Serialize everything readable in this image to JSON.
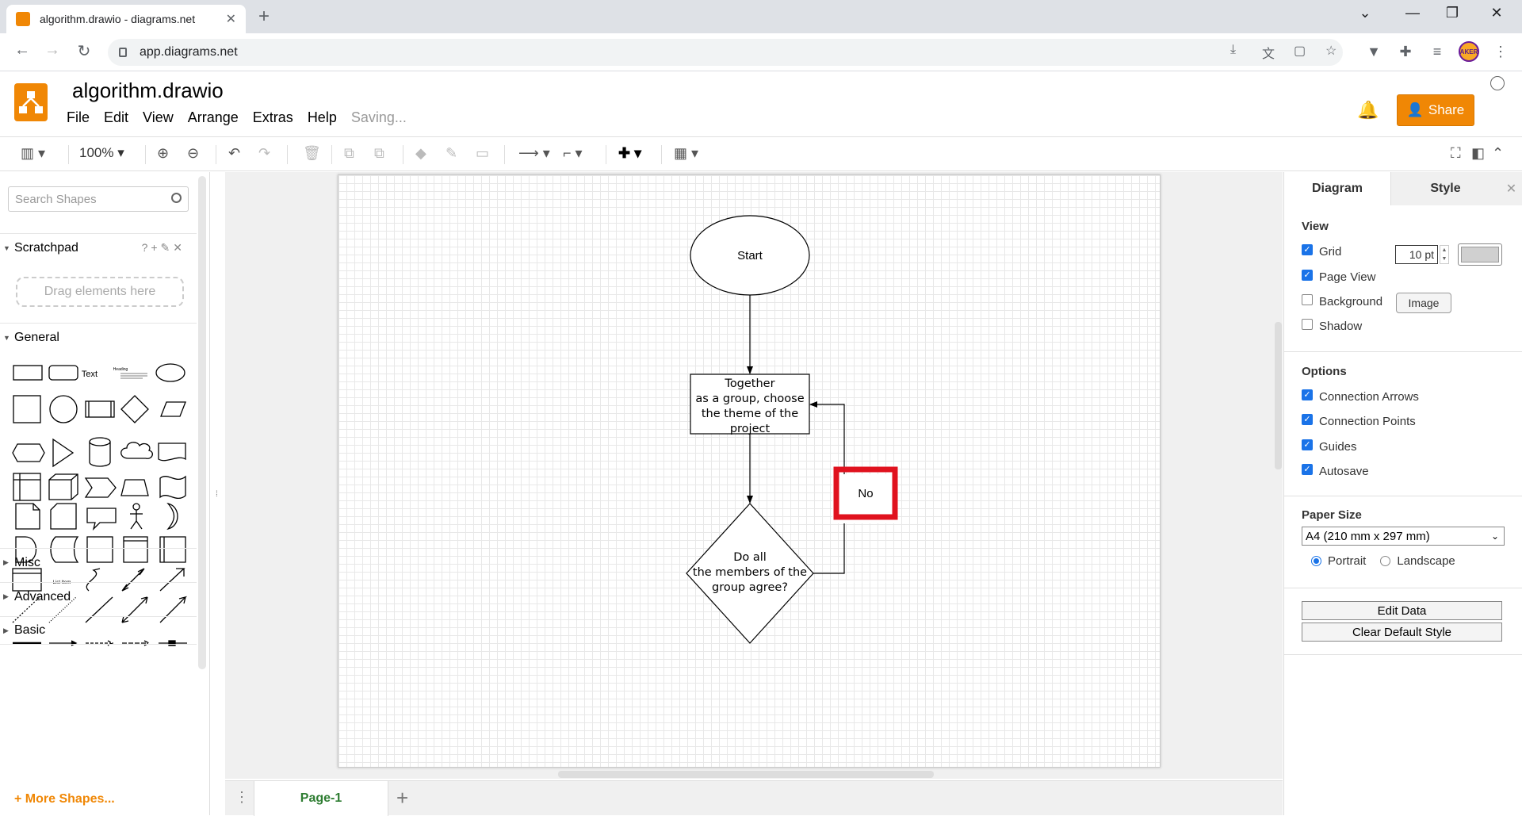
{
  "browser": {
    "tab_title": "algorithm.drawio - diagrams.net",
    "url": "app.diagrams.net",
    "avatar_text": "AKER"
  },
  "app": {
    "title": "algorithm.drawio",
    "menu": [
      "File",
      "Edit",
      "View",
      "Arrange",
      "Extras",
      "Help"
    ],
    "status": "Saving...",
    "share_label": "Share"
  },
  "toolbar": {
    "zoom": "100%"
  },
  "left_panel": {
    "search_placeholder": "Search Shapes",
    "scratchpad_label": "Scratchpad",
    "scratchpad_icons": "?+✎✕",
    "dropzone_text": "Drag elements here",
    "general_label": "General",
    "text_shape_label": "Text",
    "heading_shape_label": "Heading",
    "list_item_label": "List Item",
    "sections": [
      "Misc",
      "Advanced",
      "Basic"
    ],
    "more_shapes": "More Shapes..."
  },
  "diagram": {
    "start": "Start",
    "process": [
      "Together",
      "as a group, choose",
      "the theme of the",
      "project"
    ],
    "decision": [
      "Do all",
      "the members of the",
      "group agree?"
    ],
    "no_label": "No",
    "highlight_color": "#e0121e"
  },
  "pages": {
    "current": "Page-1"
  },
  "right_panel": {
    "tabs": [
      "Diagram",
      "Style"
    ],
    "close": "✕",
    "view_heading": "View",
    "grid_label": "Grid",
    "grid_size": "10 pt",
    "page_view_label": "Page View",
    "background_label": "Background",
    "image_button": "Image",
    "shadow_label": "Shadow",
    "options_heading": "Options",
    "options": [
      "Connection Arrows",
      "Connection Points",
      "Guides",
      "Autosave"
    ],
    "paper_heading": "Paper Size",
    "paper_size": "A4 (210 mm x 297 mm)",
    "portrait": "Portrait",
    "landscape": "Landscape",
    "edit_data": "Edit Data",
    "clear_style": "Clear Default Style"
  },
  "colors": {
    "brand": "#f08705",
    "checkbox": "#1a73e8",
    "page_tab_text": "#2e7d32"
  }
}
